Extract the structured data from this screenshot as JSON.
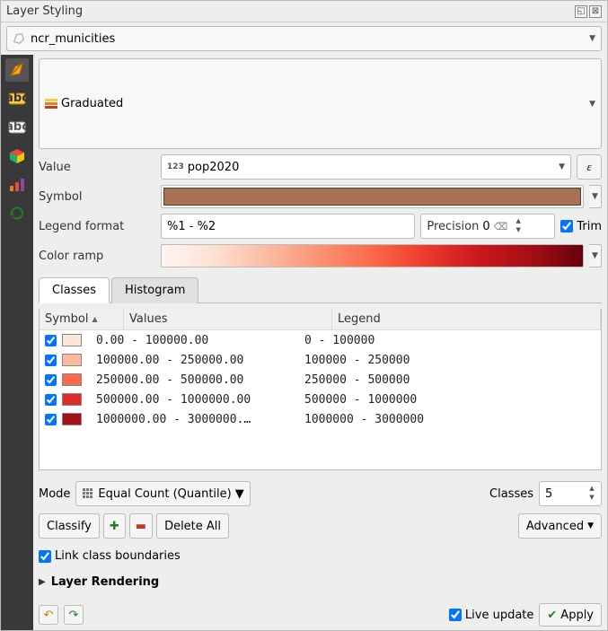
{
  "title": "Layer Styling",
  "layer_name": "ncr_municities",
  "renderer": {
    "type": "Graduated"
  },
  "value": {
    "label": "Value",
    "field": "pop2020",
    "field_type": "123"
  },
  "symbol": {
    "label": "Symbol"
  },
  "legend_format": {
    "label": "Legend format",
    "template": "%1 - %2",
    "precision_label": "Precision",
    "precision": "0",
    "trim_label": "Trim",
    "trim": true
  },
  "color_ramp": {
    "label": "Color ramp"
  },
  "tabs": {
    "classes": "Classes",
    "histogram": "Histogram"
  },
  "list": {
    "headers": {
      "symbol": "Symbol",
      "values": "Values",
      "legend": "Legend"
    },
    "rows": [
      {
        "checked": true,
        "color": "#fee5d9",
        "values": "0.00 - 100000.00",
        "legend": "0 - 100000"
      },
      {
        "checked": true,
        "color": "#fcbba1",
        "values": "100000.00 - 250000.00",
        "legend": "100000 - 250000"
      },
      {
        "checked": true,
        "color": "#fb6a4a",
        "values": "250000.00 - 500000.00",
        "legend": "250000 - 500000"
      },
      {
        "checked": true,
        "color": "#de2d26",
        "values": "500000.00 - 1000000.00",
        "legend": "500000 - 1000000"
      },
      {
        "checked": true,
        "color": "#a50f15",
        "values": "1000000.00 - 3000000.…",
        "legend": "1000000 - 3000000"
      }
    ]
  },
  "mode": {
    "label": "Mode",
    "value": "Equal Count (Quantile)"
  },
  "classes": {
    "label": "Classes",
    "value": "5"
  },
  "buttons": {
    "classify": "Classify",
    "delete_all": "Delete All",
    "advanced": "Advanced"
  },
  "link_boundaries": {
    "label": "Link class boundaries",
    "checked": true
  },
  "layer_rendering": "Layer Rendering",
  "live_update": {
    "label": "Live update",
    "checked": true
  },
  "apply": "Apply"
}
